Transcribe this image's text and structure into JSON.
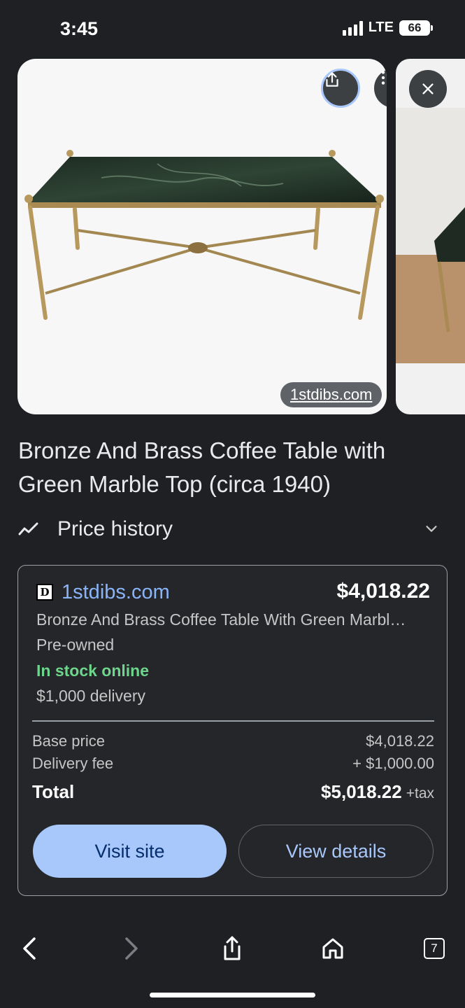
{
  "status_bar": {
    "time": "3:45",
    "network": "LTE",
    "battery": "66"
  },
  "image_viewer": {
    "source_chip": "1stdibs.com",
    "share_icon": "share-icon",
    "more_icon": "more-vert-icon",
    "close_icon": "close-icon"
  },
  "product": {
    "title": "Bronze And Brass Coffee Table with Green Marble Top (circa 1940)"
  },
  "price_history": {
    "label": "Price history",
    "icon": "trend-line-icon"
  },
  "offer": {
    "merchant_logo": "D",
    "merchant": "1stdibs.com",
    "price": "$4,018.22",
    "description": "Bronze And Brass Coffee Table With Green Marbl…",
    "condition": "Pre-owned",
    "stock": "In stock online",
    "delivery": "$1,000 delivery",
    "base_price_label": "Base price",
    "base_price_value": "$4,018.22",
    "delivery_fee_label": "Delivery fee",
    "delivery_fee_value": "+ $1,000.00",
    "total_label": "Total",
    "total_value": "$5,018.22",
    "total_tax": "+tax",
    "visit_button": "Visit site",
    "details_button": "View details"
  },
  "toolbar": {
    "tabs_count": "7"
  },
  "colors": {
    "background": "#1f2023",
    "accent": "#a8c7fa",
    "link": "#8ab4f8",
    "in_stock": "#6dd58c"
  }
}
